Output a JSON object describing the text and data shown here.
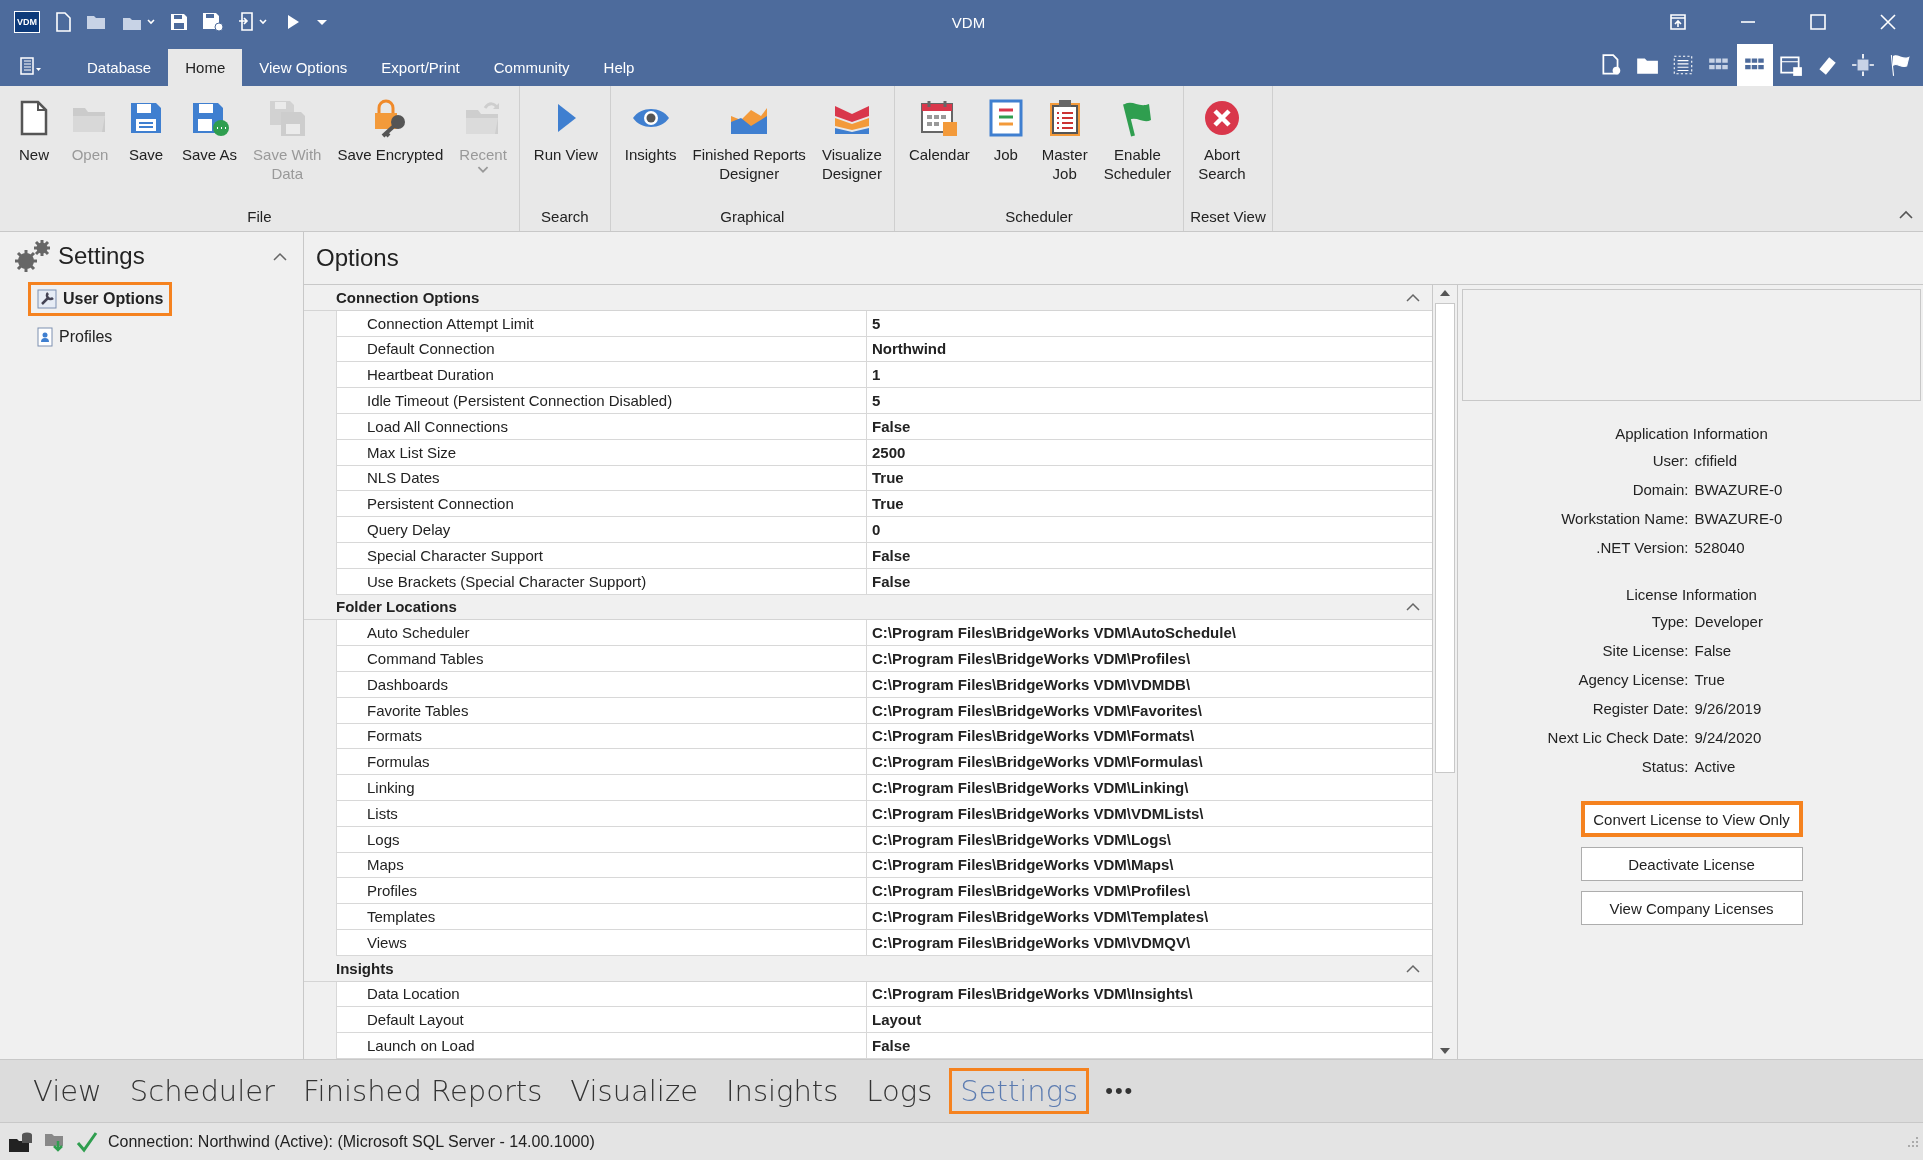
{
  "window": {
    "title": "VDM",
    "logo": "VDM"
  },
  "menu_tabs": [
    {
      "label": "Database",
      "selected": false
    },
    {
      "label": "Home",
      "selected": true
    },
    {
      "label": "View Options",
      "selected": false
    },
    {
      "label": "Export/Print",
      "selected": false
    },
    {
      "label": "Community",
      "selected": false
    },
    {
      "label": "Help",
      "selected": false
    }
  ],
  "view_buttons": [
    {
      "selected": false
    },
    {
      "selected": false
    },
    {
      "selected": false
    },
    {
      "selected": false
    },
    {
      "selected": true
    },
    {
      "selected": false
    },
    {
      "selected": false
    },
    {
      "selected": false
    },
    {
      "selected": false
    }
  ],
  "ribbon": [
    {
      "label": "File",
      "items": [
        {
          "label": "New",
          "disabled": false
        },
        {
          "label": "Open",
          "disabled": true
        },
        {
          "label": "Save",
          "disabled": false
        },
        {
          "label": "Save As",
          "disabled": false
        },
        {
          "label": "Save With\nData",
          "disabled": true
        },
        {
          "label": "Save Encrypted",
          "disabled": false
        },
        {
          "label": "Recent",
          "disabled": true,
          "dropdown": true
        }
      ]
    },
    {
      "label": "Search",
      "items": [
        {
          "label": "Run View",
          "disabled": false
        }
      ]
    },
    {
      "label": "Graphical",
      "items": [
        {
          "label": "Insights",
          "disabled": false
        },
        {
          "label": "Finished Reports\nDesigner",
          "disabled": false
        },
        {
          "label": "Visualize\nDesigner",
          "disabled": false
        }
      ]
    },
    {
      "label": "Scheduler",
      "items": [
        {
          "label": "Calendar",
          "disabled": false
        },
        {
          "label": "Job",
          "disabled": false
        },
        {
          "label": "Master\nJob",
          "disabled": false
        },
        {
          "label": "Enable\nScheduler",
          "disabled": false
        }
      ]
    },
    {
      "label": "Reset View",
      "items": [
        {
          "label": "Abort\nSearch",
          "disabled": false
        }
      ]
    }
  ],
  "sidebar": {
    "title": "Settings",
    "items": [
      {
        "label": "User Options",
        "selected": true
      },
      {
        "label": "Profiles",
        "selected": false
      }
    ]
  },
  "options": {
    "title": "Options",
    "sections": [
      {
        "title": "Connection Options",
        "expanded": true,
        "rows": [
          {
            "name": "Connection Attempt Limit",
            "value": "5"
          },
          {
            "name": "Default Connection",
            "value": "Northwind"
          },
          {
            "name": "Heartbeat Duration",
            "value": "1"
          },
          {
            "name": "Idle Timeout (Persistent Connection Disabled)",
            "value": "5"
          },
          {
            "name": "Load All Connections",
            "value": "False"
          },
          {
            "name": "Max List Size",
            "value": "2500"
          },
          {
            "name": "NLS Dates",
            "value": "True"
          },
          {
            "name": "Persistent Connection",
            "value": "True"
          },
          {
            "name": "Query Delay",
            "value": "0"
          },
          {
            "name": "Special Character Support",
            "value": "False"
          },
          {
            "name": "Use Brackets (Special Character Support)",
            "value": "False"
          }
        ]
      },
      {
        "title": "Folder Locations",
        "expanded": true,
        "rows": [
          {
            "name": "Auto Scheduler",
            "value": "C:\\Program Files\\BridgeWorks VDM\\AutoSchedule\\"
          },
          {
            "name": "Command Tables",
            "value": "C:\\Program Files\\BridgeWorks VDM\\Profiles\\"
          },
          {
            "name": "Dashboards",
            "value": "C:\\Program Files\\BridgeWorks VDM\\VDMDB\\"
          },
          {
            "name": "Favorite Tables",
            "value": "C:\\Program Files\\BridgeWorks VDM\\Favorites\\"
          },
          {
            "name": "Formats",
            "value": "C:\\Program Files\\BridgeWorks VDM\\Formats\\"
          },
          {
            "name": "Formulas",
            "value": "C:\\Program Files\\BridgeWorks VDM\\Formulas\\"
          },
          {
            "name": "Linking",
            "value": "C:\\Program Files\\BridgeWorks VDM\\Linking\\"
          },
          {
            "name": "Lists",
            "value": "C:\\Program Files\\BridgeWorks VDM\\VDMLists\\"
          },
          {
            "name": "Logs",
            "value": "C:\\Program Files\\BridgeWorks VDM\\Logs\\"
          },
          {
            "name": "Maps",
            "value": "C:\\Program Files\\BridgeWorks VDM\\Maps\\"
          },
          {
            "name": "Profiles",
            "value": "C:\\Program Files\\BridgeWorks VDM\\Profiles\\"
          },
          {
            "name": "Templates",
            "value": "C:\\Program Files\\BridgeWorks VDM\\Templates\\"
          },
          {
            "name": "Views",
            "value": "C:\\Program Files\\BridgeWorks VDM\\VDMQV\\"
          }
        ]
      },
      {
        "title": "Insights",
        "expanded": true,
        "rows": [
          {
            "name": "Data Location",
            "value": "C:\\Program Files\\BridgeWorks VDM\\Insights\\"
          },
          {
            "name": "Default Layout",
            "value": "Layout"
          },
          {
            "name": "Launch on Load",
            "value": "False"
          }
        ]
      }
    ]
  },
  "info_panel": {
    "groups": [
      {
        "title": "Application Information",
        "fields": [
          {
            "label": "User:",
            "value": "cfifield"
          },
          {
            "label": "Domain:",
            "value": "BWAZURE-0"
          },
          {
            "label": "Workstation Name:",
            "value": "BWAZURE-0"
          },
          {
            "label": ".NET Version:",
            "value": "528040"
          }
        ]
      },
      {
        "title": "License Information",
        "fields": [
          {
            "label": "Type:",
            "value": "Developer"
          },
          {
            "label": "Site License:",
            "value": "False"
          },
          {
            "label": "Agency License:",
            "value": "True"
          },
          {
            "label": "Register Date:",
            "value": "9/26/2019"
          },
          {
            "label": "Next Lic Check Date:",
            "value": "9/24/2020"
          },
          {
            "label": "Status:",
            "value": "Active"
          }
        ]
      }
    ],
    "buttons": [
      {
        "label": "Convert License to View Only",
        "highlighted": true
      },
      {
        "label": "Deactivate License",
        "highlighted": false
      },
      {
        "label": "View Company Licenses",
        "highlighted": false
      }
    ]
  },
  "bottom_nav": {
    "tabs": [
      {
        "label": "View",
        "selected": false
      },
      {
        "label": "Scheduler",
        "selected": false
      },
      {
        "label": "Finished Reports",
        "selected": false
      },
      {
        "label": "Visualize",
        "selected": false
      },
      {
        "label": "Insights",
        "selected": false
      },
      {
        "label": "Logs",
        "selected": false
      },
      {
        "label": "Settings",
        "selected": true
      }
    ],
    "more": "•••"
  },
  "status_bar": {
    "text": "Connection: Northwind (Active): (Microsoft SQL Server - 14.00.1000)"
  }
}
